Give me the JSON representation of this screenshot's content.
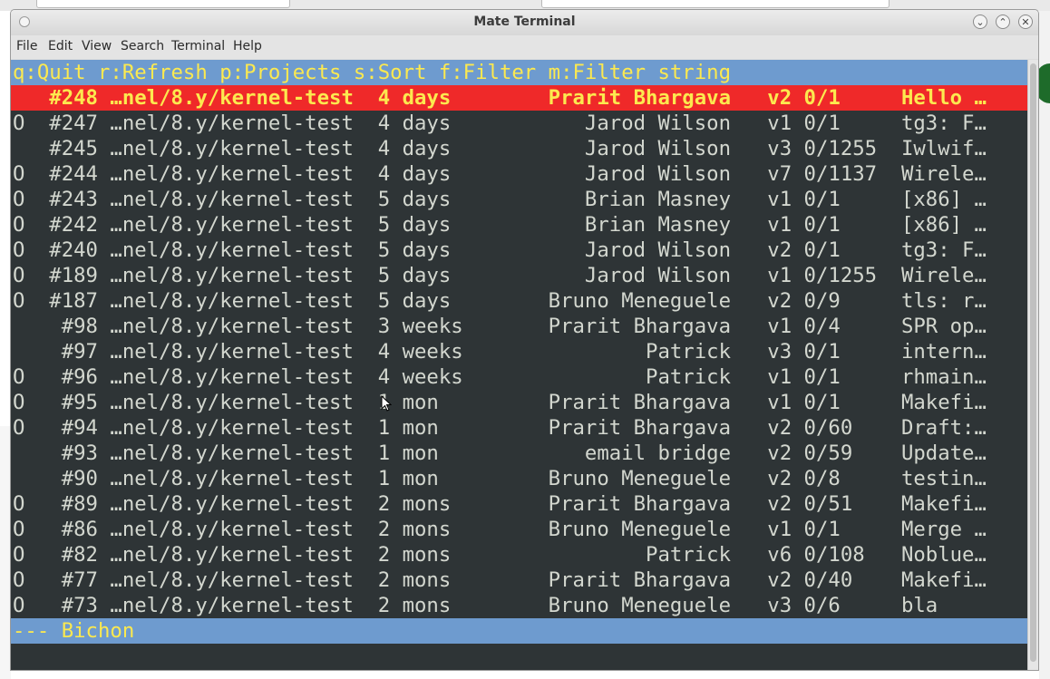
{
  "window": {
    "title": "Mate Terminal"
  },
  "menu": [
    "File",
    "Edit",
    "View",
    "Search",
    "Terminal",
    "Help"
  ],
  "terminal": {
    "help_line": "q:Quit r:Refresh p:Projects s:Sort f:Filter m:Filter string",
    "header": "   #248 …nel/8.y/kernel-test  4 days        Prarit Bhargava   v2 0/1     Hello …",
    "rows": [
      "O  #247 …nel/8.y/kernel-test  4 days           Jarod Wilson   v1 0/1     tg3: F…",
      "   #245 …nel/8.y/kernel-test  4 days           Jarod Wilson   v3 0/1255  Iwlwif…",
      "O  #244 …nel/8.y/kernel-test  4 days           Jarod Wilson   v7 0/1137  Wirele…",
      "O  #243 …nel/8.y/kernel-test  5 days           Brian Masney   v1 0/1     [x86] …",
      "O  #242 …nel/8.y/kernel-test  5 days           Brian Masney   v1 0/1     [x86] …",
      "O  #240 …nel/8.y/kernel-test  5 days           Jarod Wilson   v2 0/1     tg3: F…",
      "O  #189 …nel/8.y/kernel-test  5 days           Jarod Wilson   v1 0/1255  Wirele…",
      "O  #187 …nel/8.y/kernel-test  5 days        Bruno Meneguele   v2 0/9     tls: r…",
      "    #98 …nel/8.y/kernel-test  3 weeks       Prarit Bhargava   v1 0/4     SPR op…",
      "    #97 …nel/8.y/kernel-test  4 weeks               Patrick   v3 0/1     intern…",
      "O   #96 …nel/8.y/kernel-test  4 weeks               Patrick   v1 0/1     rhmain…",
      "O   #95 …nel/8.y/kernel-test  1 mon         Prarit Bhargava   v1 0/1     Makefi…",
      "O   #94 …nel/8.y/kernel-test  1 mon         Prarit Bhargava   v2 0/60    Draft:…",
      "    #93 …nel/8.y/kernel-test  1 mon            email bridge   v2 0/59    Update…",
      "    #90 …nel/8.y/kernel-test  1 mon         Bruno Meneguele   v2 0/8     testin…",
      "O   #89 …nel/8.y/kernel-test  2 mons        Prarit Bhargava   v2 0/51    Makefi…",
      "O   #86 …nel/8.y/kernel-test  2 mons        Bruno Meneguele   v1 0/1     Merge …",
      "O   #82 …nel/8.y/kernel-test  2 mons                Patrick   v6 0/108   Noblue…",
      "O   #77 …nel/8.y/kernel-test  2 mons        Prarit Bhargava   v2 0/40    Makefi…",
      "O   #73 …nel/8.y/kernel-test  2 mons        Bruno Meneguele   v3 0/6     bla"
    ],
    "status_line": "--- Bichon"
  },
  "colors": {
    "terminal_bg": "#2e3436",
    "terminal_fg": "#d3d7cf",
    "highlight_blue": "#6e9bcf",
    "highlight_red": "#ef2929",
    "highlight_text": "#fce94f"
  },
  "icons": {
    "window_controls": [
      "minimize-icon",
      "maximize-icon",
      "close-icon"
    ],
    "cursor": "mouse-pointer-icon"
  }
}
